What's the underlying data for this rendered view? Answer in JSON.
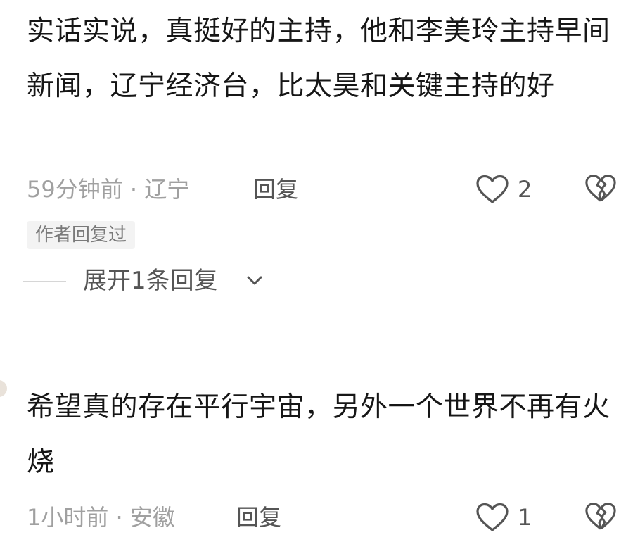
{
  "comments": [
    {
      "text": "实话实说，真挺好的主持，他和李美玲主持早间新闻，辽宁经济台，比太昊和关键主持的好",
      "time_location": "59分钟前 · 辽宁",
      "reply_label": "回复",
      "like_count": "2",
      "author_badge": "作者回复过",
      "expand_label": "展开1条回复"
    },
    {
      "text": "希望真的存在平行宇宙，另外一个世界不再有火烧",
      "time_location": "1小时前 · 安徽",
      "reply_label": "回复",
      "like_count": "1"
    }
  ],
  "icons": {
    "like": "heart-outline-icon",
    "dislike": "broken-heart-icon",
    "expand": "chevron-down-icon"
  },
  "colors": {
    "text": "#161616",
    "meta": "#a0a0a0",
    "action": "#555555",
    "badge_bg": "#f3f3f3"
  }
}
